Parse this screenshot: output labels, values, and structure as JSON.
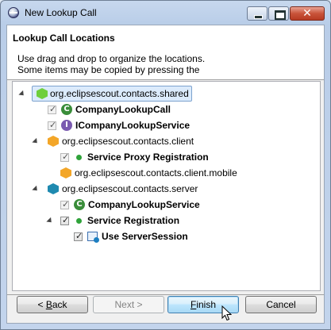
{
  "window": {
    "title": "New Lookup Call",
    "controls": {
      "minimize": "",
      "maximize": "",
      "close": "✕"
    }
  },
  "header": {
    "title": "Lookup Call Locations",
    "description_lines": [
      "Use drag and drop to organize the locations.",
      "Some items may be copied by pressing the"
    ]
  },
  "tree": {
    "nodes": [
      {
        "label": "org.eclipsescout.contacts.shared",
        "icon": "shared-project-icon",
        "bold": false,
        "expanded": true,
        "checkbox": "none",
        "selected": true
      },
      {
        "label": "CompanyLookupCall",
        "icon": "class-icon",
        "bold": true,
        "checkbox": "checked-disabled"
      },
      {
        "label": "ICompanyLookupService",
        "icon": "interface-icon",
        "bold": true,
        "checkbox": "checked-disabled"
      },
      {
        "label": "org.eclipsescout.contacts.client",
        "icon": "client-project-icon",
        "bold": false,
        "expanded": true,
        "checkbox": "none"
      },
      {
        "label": "Service Proxy Registration",
        "icon": "registration-icon",
        "bold": true,
        "checkbox": "checked-disabled"
      },
      {
        "label": "org.eclipsescout.contacts.client.mobile",
        "icon": "client-mobile-project-icon",
        "bold": false,
        "checkbox": "none"
      },
      {
        "label": "org.eclipsescout.contacts.server",
        "icon": "server-project-icon",
        "bold": false,
        "expanded": true,
        "checkbox": "none"
      },
      {
        "label": "CompanyLookupService",
        "icon": "class-icon",
        "bold": true,
        "checkbox": "checked-disabled"
      },
      {
        "label": "Service Registration",
        "icon": "registration-icon",
        "bold": true,
        "expanded": true,
        "checkbox": "checked"
      },
      {
        "label": "Use ServerSession",
        "icon": "server-session-icon",
        "bold": true,
        "checkbox": "checked"
      }
    ]
  },
  "buttons": {
    "back": {
      "label_mn": "B",
      "label_rest": "ack",
      "prefix": "< "
    },
    "next": {
      "label": "Next >",
      "enabled": false
    },
    "finish": {
      "label_mn": "F",
      "label_rest": "inish"
    },
    "cancel": {
      "label": "Cancel"
    }
  },
  "icons": {
    "check_glyph": "✓",
    "class_glyph": "C",
    "interface_glyph": "I"
  },
  "colors": {
    "selection_bg": "#dcebfc",
    "selection_border": "#7da2ce",
    "default_button_border": "#3c7fb1"
  }
}
